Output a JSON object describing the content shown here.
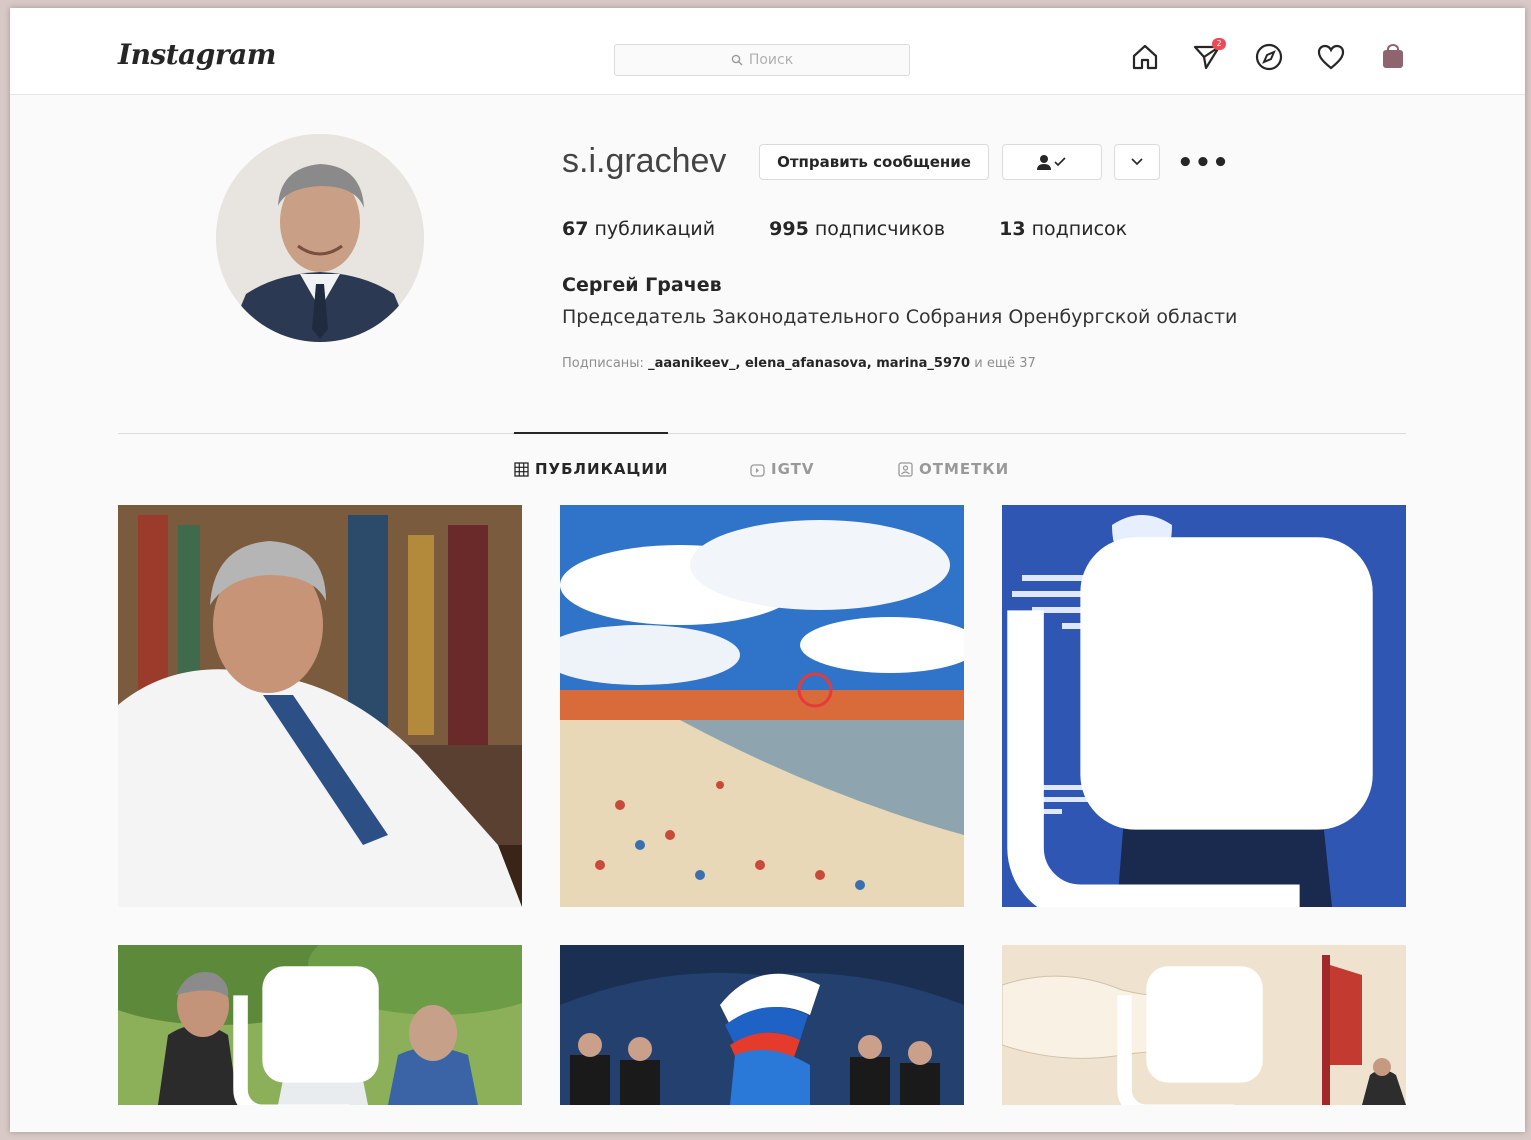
{
  "header": {
    "logo": "Instagram",
    "search_placeholder": "Поиск",
    "direct_badge": "2"
  },
  "profile": {
    "username": "s.i.grachev",
    "message_button": "Отправить сообщение",
    "stats": {
      "posts_count": "67",
      "posts_label": "публикаций",
      "followers_count": "995",
      "followers_label": "подписчиков",
      "following_count": "13",
      "following_label": "подписок"
    },
    "full_name": "Сергей Грачев",
    "bio": "Председатель Законодательного Собрания Оренбургской области",
    "followed_by_prefix": "Подписаны:",
    "followed_by_users": "_aaanikeev_, elena_afanasova, marina_5970",
    "followed_by_suffix": "и ещё 37"
  },
  "tabs": [
    {
      "label": "ПУБЛИКАЦИИ"
    },
    {
      "label": "IGTV"
    },
    {
      "label": "ОТМЕТКИ"
    }
  ],
  "colors": {
    "badge": "#ed4956",
    "shop_icon": "#8e6470"
  }
}
